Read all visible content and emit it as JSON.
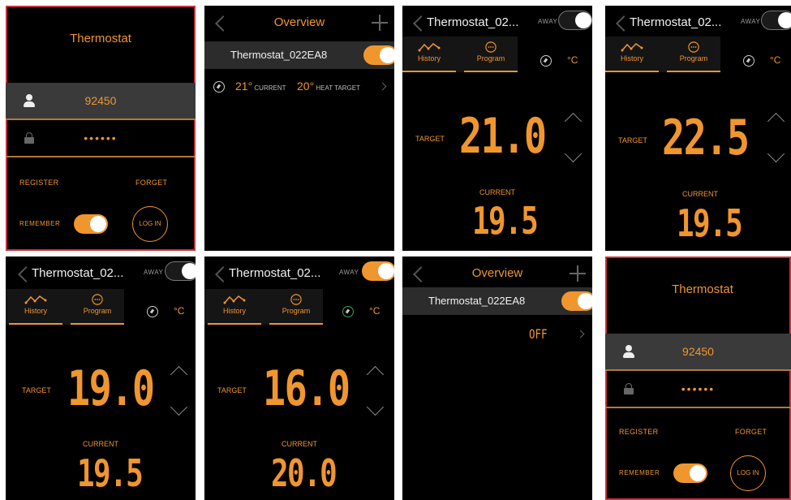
{
  "login": {
    "title": "Thermostat",
    "username": "92450",
    "password": "••••••",
    "register": "REGISTER",
    "forget": "FORGET",
    "remember": "REMEMBER",
    "login_button": "LOG IN",
    "remember_on": true
  },
  "overview": {
    "title": "Overview",
    "device_name": "Thermostat_022EA8",
    "current_temp": "21°",
    "current_label": "CURRENT",
    "target_temp": "20°",
    "target_label": "HEAT TARGET",
    "off_text": "OFF"
  },
  "detail": {
    "title": "Thermostat_02...",
    "away_label": "AWAY",
    "tab_history": "History",
    "tab_program": "Program",
    "unit": "°C",
    "target_label": "TARGET",
    "current_label": "CURRENT"
  },
  "screens": [
    {
      "target": "21.0",
      "current": "19.5",
      "away_on": false
    },
    {
      "target": "22.5",
      "current": "19.5",
      "away_on": false
    },
    {
      "target": "19.0",
      "current": "19.5",
      "away_on": false
    },
    {
      "target": "16.0",
      "current": "20.0",
      "away_on": true
    }
  ],
  "colors": {
    "accent": "#f0962e",
    "panel": "#000000",
    "highlight_border": "#c8323a"
  },
  "icons": [
    "user-icon",
    "lock-icon",
    "back-chevron-icon",
    "plus-icon",
    "history-icon",
    "program-icon",
    "eco-leaf-icon",
    "arrow-up-icon",
    "arrow-down-icon",
    "chevron-right-icon"
  ]
}
